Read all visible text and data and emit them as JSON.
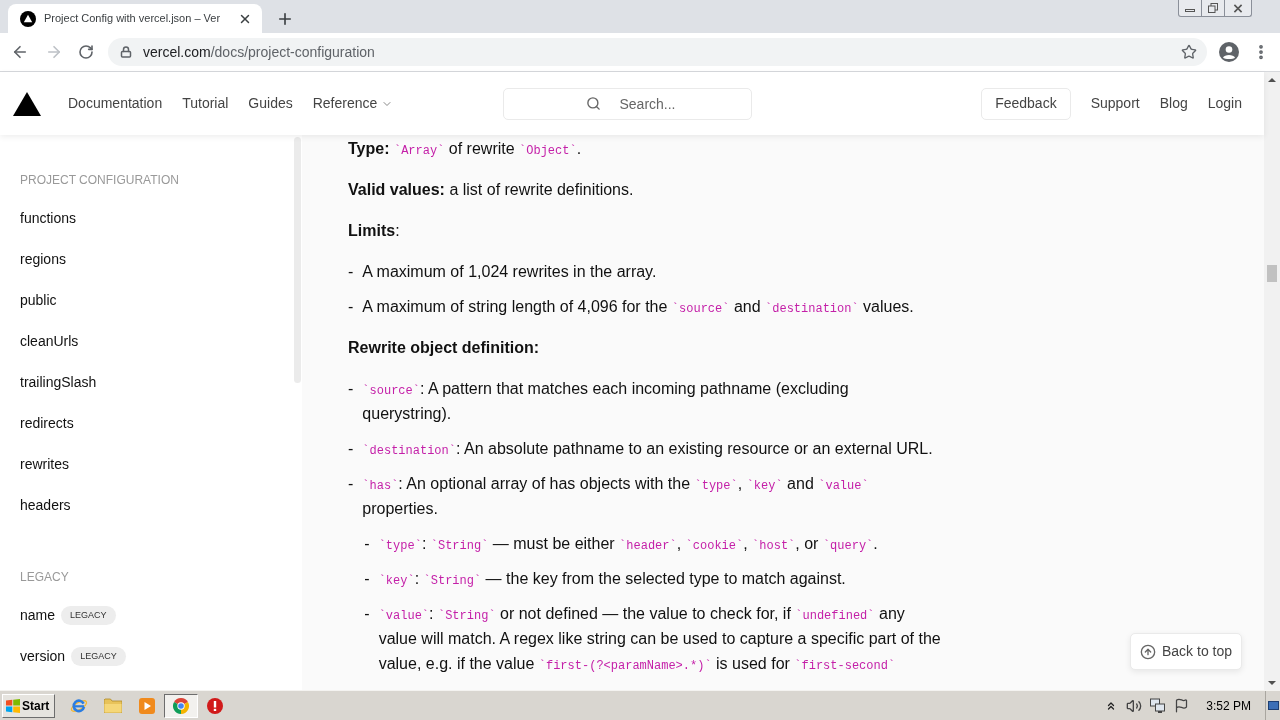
{
  "browser": {
    "tabs": [
      {
        "title": "Project Config with vercel.json – Ver",
        "selected": true
      }
    ],
    "forward_disabled": true,
    "url": {
      "host": "vercel.com",
      "path": "/docs/project-configuration"
    }
  },
  "nav": {
    "links": [
      {
        "label": "Documentation",
        "dropdown": false
      },
      {
        "label": "Tutorial",
        "dropdown": false
      },
      {
        "label": "Guides",
        "dropdown": false
      },
      {
        "label": "Reference",
        "dropdown": true
      }
    ],
    "search": {
      "placeholder": "Search..."
    },
    "feedback": "Feedback",
    "right_links": [
      "Support",
      "Blog",
      "Login"
    ]
  },
  "sidebar": {
    "sections": [
      {
        "heading": "PROJECT CONFIGURATION",
        "items": [
          {
            "label": "functions"
          },
          {
            "label": "regions"
          },
          {
            "label": "public"
          },
          {
            "label": "cleanUrls"
          },
          {
            "label": "trailingSlash"
          },
          {
            "label": "redirects"
          },
          {
            "label": "rewrites"
          },
          {
            "label": "headers"
          }
        ]
      },
      {
        "heading": "LEGACY",
        "items": [
          {
            "label": "name",
            "badge": "LEGACY"
          },
          {
            "label": "version",
            "badge": "LEGACY"
          }
        ]
      }
    ]
  },
  "content": {
    "blocks": [
      {
        "kind": "para",
        "parts": [
          {
            "kind": "bold",
            "text": "Type: "
          },
          {
            "kind": "code",
            "text": "`Array`"
          },
          {
            "kind": "text",
            "text": " of rewrite "
          },
          {
            "kind": "code",
            "text": "`Object`"
          },
          {
            "kind": "text",
            "text": "."
          }
        ]
      },
      {
        "kind": "para",
        "parts": [
          {
            "kind": "bold",
            "text": "Valid values:"
          },
          {
            "kind": "text",
            "text": " a list of rewrite definitions."
          }
        ]
      },
      {
        "kind": "para",
        "parts": [
          {
            "kind": "bold",
            "text": "Limits"
          },
          {
            "kind": "text",
            "text": ":"
          }
        ]
      },
      {
        "kind": "list",
        "items": [
          {
            "marker": "-",
            "parts": [
              {
                "kind": "text",
                "text": "A maximum of 1,024 rewrites in the array."
              }
            ]
          },
          {
            "marker": "-",
            "parts": [
              {
                "kind": "text",
                "text": "A maximum of string length of 4,096 for the "
              },
              {
                "kind": "code",
                "text": "`source`"
              },
              {
                "kind": "text",
                "text": " and "
              },
              {
                "kind": "code",
                "text": "`destination`"
              },
              {
                "kind": "text",
                "text": " values."
              }
            ]
          }
        ]
      },
      {
        "kind": "heading",
        "text": "Rewrite object definition:"
      },
      {
        "kind": "list",
        "items": [
          {
            "marker": "-",
            "parts": [
              {
                "kind": "code",
                "text": "`source`"
              },
              {
                "kind": "text",
                "text": ": A pattern that matches each incoming pathname (excluding querystring)."
              }
            ]
          },
          {
            "marker": "-",
            "parts": [
              {
                "kind": "code",
                "text": "`destination`"
              },
              {
                "kind": "text",
                "text": ": An absolute pathname to an existing resource or an external URL."
              }
            ]
          },
          {
            "marker": "-",
            "parts": [
              {
                "kind": "code",
                "text": "`has`"
              },
              {
                "kind": "text",
                "text": ": An optional array of has objects with the "
              },
              {
                "kind": "code",
                "text": "`type`"
              },
              {
                "kind": "text",
                "text": ", "
              },
              {
                "kind": "code",
                "text": "`key`"
              },
              {
                "kind": "text",
                "text": " and "
              },
              {
                "kind": "code",
                "text": "`value`"
              },
              {
                "kind": "text",
                "text": " properties."
              }
            ],
            "children": [
              {
                "marker": "-",
                "parts": [
                  {
                    "kind": "code",
                    "text": "`type`"
                  },
                  {
                    "kind": "text",
                    "text": ": "
                  },
                  {
                    "kind": "code",
                    "text": "`String`"
                  },
                  {
                    "kind": "text",
                    "text": " — must be either "
                  },
                  {
                    "kind": "code",
                    "text": "`header`"
                  },
                  {
                    "kind": "text",
                    "text": ", "
                  },
                  {
                    "kind": "code",
                    "text": "`cookie`"
                  },
                  {
                    "kind": "text",
                    "text": ", "
                  },
                  {
                    "kind": "code",
                    "text": "`host`"
                  },
                  {
                    "kind": "text",
                    "text": ", or "
                  },
                  {
                    "kind": "code",
                    "text": "`query`"
                  },
                  {
                    "kind": "text",
                    "text": "."
                  }
                ]
              },
              {
                "marker": "-",
                "parts": [
                  {
                    "kind": "code",
                    "text": "`key`"
                  },
                  {
                    "kind": "text",
                    "text": ": "
                  },
                  {
                    "kind": "code",
                    "text": "`String`"
                  },
                  {
                    "kind": "text",
                    "text": " — the key from the selected type to match against."
                  }
                ]
              },
              {
                "marker": "-",
                "parts": [
                  {
                    "kind": "code",
                    "text": "`value`"
                  },
                  {
                    "kind": "text",
                    "text": ": "
                  },
                  {
                    "kind": "code",
                    "text": "`String`"
                  },
                  {
                    "kind": "text",
                    "text": " or not defined — the value to check for, if "
                  },
                  {
                    "kind": "code",
                    "text": "`undefined`"
                  },
                  {
                    "kind": "text",
                    "text": " any value will match. A regex like string can be used to capture a specific part of the value, e.g. if the value "
                  },
                  {
                    "kind": "code",
                    "text": "`first-(?<paramName>.*)`"
                  },
                  {
                    "kind": "text",
                    "text": " is used for "
                  },
                  {
                    "kind": "code",
                    "text": "`first-second`"
                  }
                ]
              }
            ]
          }
        ]
      }
    ]
  },
  "back_to_top": "Back to top",
  "taskbar": {
    "start": "Start",
    "apps": [
      {
        "kind": "e-browser",
        "selected": false
      },
      {
        "kind": "folder",
        "selected": false
      },
      {
        "kind": "media",
        "selected": false
      },
      {
        "kind": "round-browser",
        "selected": true
      },
      {
        "kind": "alert",
        "selected": false
      }
    ],
    "clock": "3:52 PM"
  }
}
